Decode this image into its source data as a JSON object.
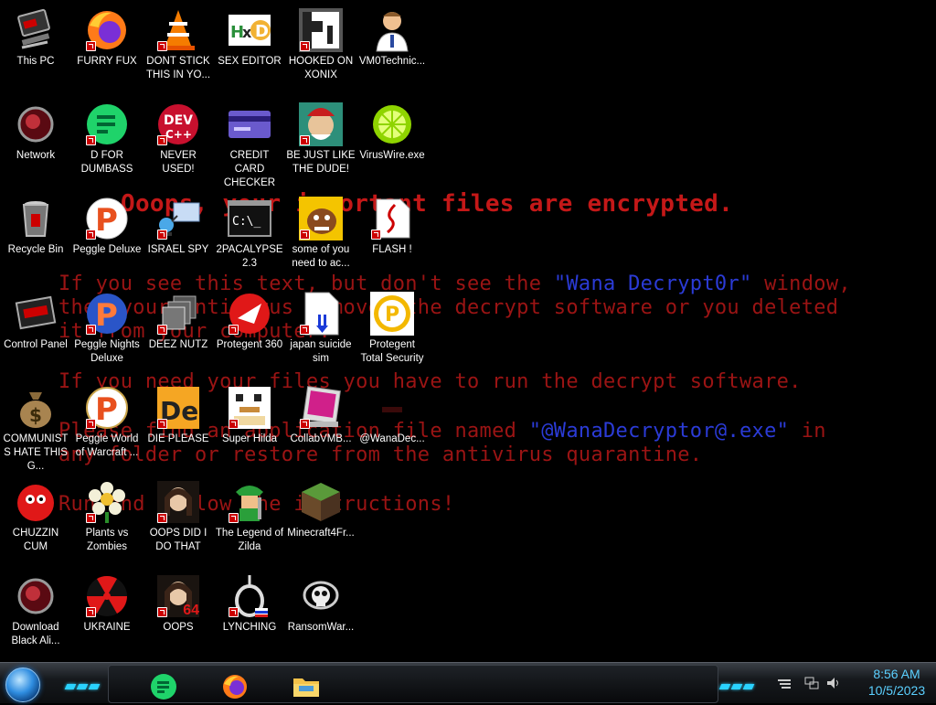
{
  "wallpaper": {
    "line1": "Ooops, your important files are encrypted.",
    "line2a": "If you see this text, but don't see the ",
    "line2b": "\"Wana Decrypt0r\"",
    "line2c": " window,",
    "line3": "then your antivirus removed the decrypt software or you deleted",
    "line4": "it from your computer.",
    "line5": "If you need your files you have to run the decrypt software.",
    "line6a": "Please find an application file named ",
    "line6b": "\"@WanaDecryptor@.exe\"",
    "line6c": " in",
    "line7": "any folder or restore from the antivirus quarantine.",
    "line8": "Run and follow the instructions!"
  },
  "icons": {
    "this_pc": "This PC",
    "furry_fux": "FURRY FUX",
    "dont_stick": "DONT STICK THIS IN YO...",
    "sex_editor": "SEX EDITOR",
    "hooked_on_xonix": "HOOKED ON XONIX",
    "vm0technic": "VM0Technic...",
    "network": "Network",
    "d_for_dumbass": "D FOR DUMBASS",
    "never_used": "NEVER USED!",
    "credit_card_checker": "CREDIT CARD CHECKER",
    "be_just_like": "BE JUST LIKE THE DUDE!",
    "viruswire": "VirusWire.exe",
    "recycle_bin": "Recycle Bin",
    "peggle_deluxe": "Peggle Deluxe",
    "israel_spy": "ISRAEL SPY",
    "twopacalypse": "2PACALYPSE 2.3",
    "some_of_you": "some of you need to ac...",
    "flash": "FLASH !",
    "control_panel": "Control Panel",
    "peggle_nights": "Peggle Nights Deluxe",
    "deez_nutz": "DEEZ NUTZ",
    "protegent360": "Protegent 360",
    "japan_suicide": "japan suicide sim",
    "protegent_total": "Protegent Total Security",
    "communists": "COMMUNISTS HATE THIS G...",
    "peggle_world": "Peggle World of Warcraft ...",
    "die_please": "DIE PLEASE",
    "super_hilda": "Super Hilda",
    "collabvmb": "CollabVMB...",
    "wanadec": "@WanaDec...",
    "chuzzin_cum": "CHUZZIN CUM",
    "plants_vs_zombies": "Plants vs Zombies",
    "oops_did_i": "OOPS DID I DO THAT",
    "legend_zilda": "The Legend of Zilda",
    "minecraft": "Minecraft4Fr...",
    "download_black": "Download Black Ali...",
    "ukraine": "UKRAINE",
    "oops": "OOPS",
    "oops_badge": "64",
    "lynching": "LYNCHING",
    "ransomwar": "RansomWar..."
  },
  "taskbar": {
    "clock_time": "8:56 AM",
    "clock_date": "10/5/2023"
  },
  "colors": {
    "wallpaper_red": "#9b1414",
    "wallpaper_blue": "#2b3bd6",
    "clock": "#5bd0ff"
  }
}
